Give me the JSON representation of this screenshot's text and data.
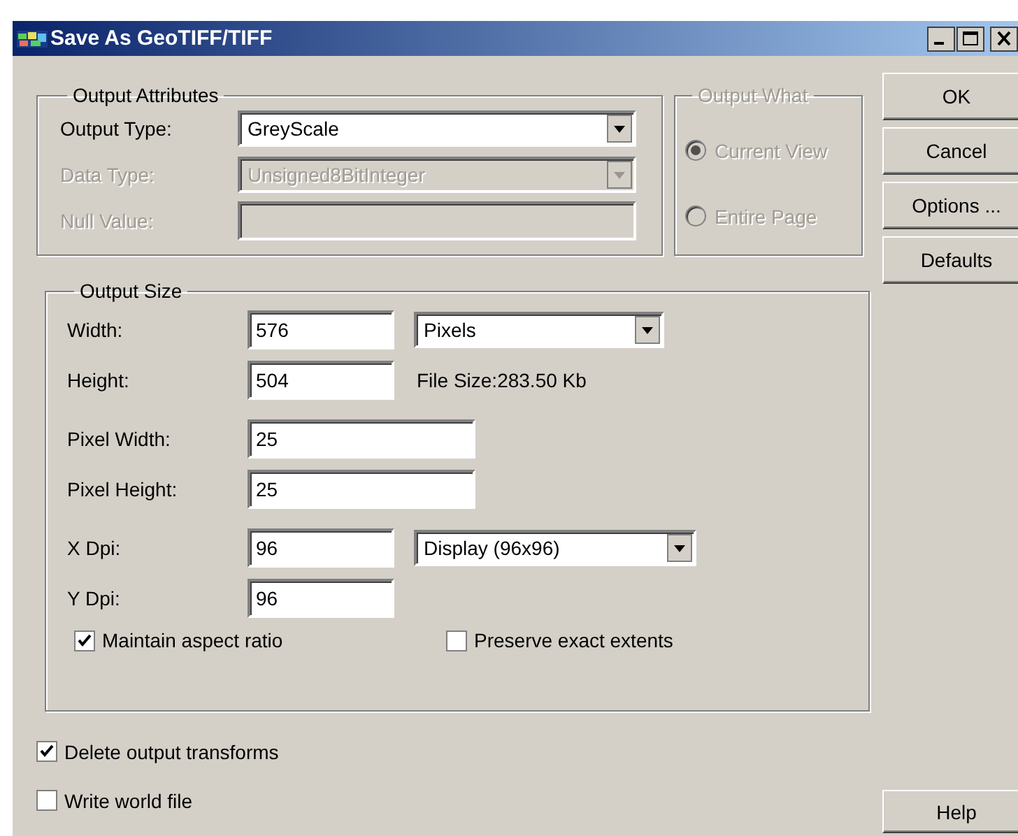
{
  "window": {
    "title": "Save As GeoTIFF/TIFF"
  },
  "output_attributes": {
    "title": "Output Attributes",
    "fields": [
      {
        "label": "Output Type:",
        "kind": "dropdown",
        "value": "GreyScale",
        "disabled": false
      },
      {
        "label": "Data Type:",
        "kind": "dropdown",
        "value": "Unsigned8BitInteger",
        "disabled": true
      },
      {
        "label": "Null Value:",
        "kind": "text",
        "disabled": true
      }
    ]
  },
  "output_what": {
    "title": "Output What",
    "disabled": true,
    "options": [
      {
        "label": "Current View",
        "selected": true
      },
      {
        "label": "Entire Page",
        "selected": false
      }
    ]
  },
  "buttons": [
    "OK",
    "Cancel",
    "Options ...",
    "Defaults"
  ],
  "output_size": {
    "title": "Output Size",
    "width": {
      "label": "Width:",
      "value": "576"
    },
    "unit": "Pixels",
    "height": {
      "label": "Height:",
      "value": "504"
    },
    "file_size": "File Size:283.50 Kb",
    "pixel_width": {
      "label": "Pixel Width:",
      "value": "25"
    },
    "pixel_height": {
      "label": "Pixel Height:",
      "value": "25"
    },
    "x_dpi": {
      "label": "X Dpi:",
      "value": "96"
    },
    "dpi_preset": "Display (96x96)",
    "y_dpi": {
      "label": "Y Dpi:",
      "value": "96"
    },
    "checkboxes": [
      {
        "label": "Maintain aspect ratio",
        "checked": true
      },
      {
        "label": "Preserve exact extents",
        "checked": false
      }
    ]
  },
  "options": [
    {
      "label": "Delete output transforms",
      "checked": true
    },
    {
      "label": "Write world file",
      "checked": false
    }
  ],
  "help_button": "Help"
}
